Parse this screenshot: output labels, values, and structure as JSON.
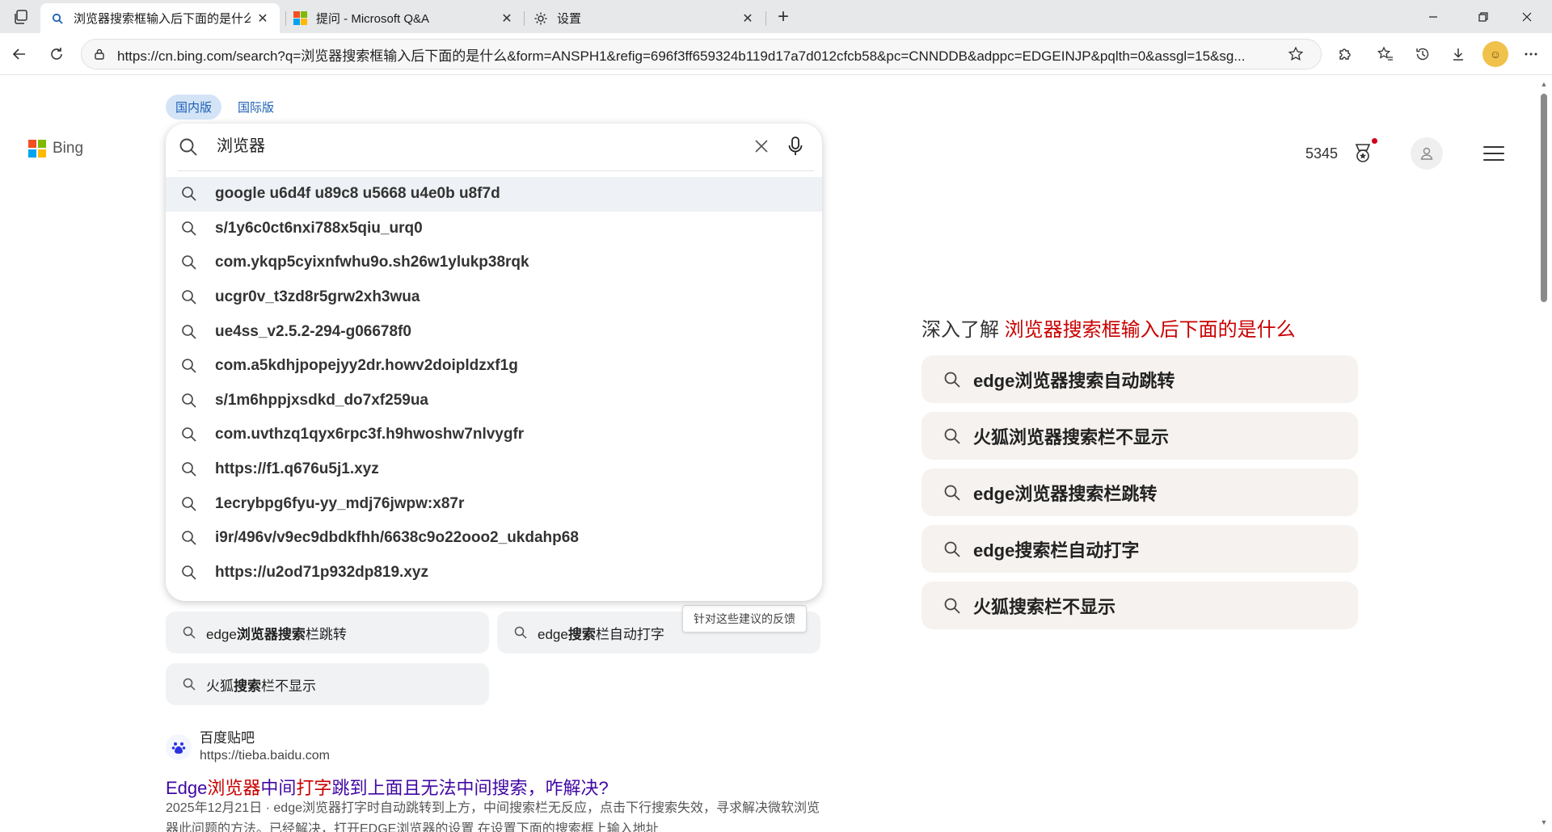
{
  "tabs": [
    {
      "title": "浏览器搜索框输入后下面的是什么",
      "active": true
    },
    {
      "title": "提问 - Microsoft Q&A",
      "active": false
    },
    {
      "title": "设置",
      "active": false
    }
  ],
  "address_bar": {
    "url": "https://cn.bing.com/search?q=浏览器搜索框输入后下面的是什么&form=ANSPH1&refig=696f3ff659324b119d17a7d012cfcb58&pc=CNNDDB&adppc=EDGEINJP&pqlth=0&assgl=15&sg..."
  },
  "bing": {
    "logo_text": "Bing",
    "market_tabs": [
      "国内版",
      "国际版"
    ],
    "points": "5345"
  },
  "search": {
    "query": "浏览器",
    "suggestions": [
      "google u6d4f u89c8 u5668 u4e0b u8f7d",
      "s/1y6c0ct6nxi788x5qiu_urq0",
      "com.ykqp5cyixnfwhu9o.sh26w1ylukp38rqk",
      "ucgr0v_t3zd8r5grw2xh3wua",
      "ue4ss_v2.5.2-294-g06678f0",
      "com.a5kdhjpopejyy2dr.howv2doipldzxf1g",
      "s/1m6hppjxsdkd_do7xf259ua",
      "com.uvthzq1qyx6rpc3f.h9hwoshw7nlvygfr",
      "https://f1.q676u5j1.xyz",
      "1ecrybpg6fyu-yy_mdj76jwpw:x87r",
      "i9r/496v/v9ec9dbdkfhh/6638c9o22ooo2_ukdahp68",
      "https://u2od71p932dp819.xyz"
    ]
  },
  "related_pills": [
    {
      "pre": "edge",
      "bold": "浏览器搜索",
      "post": "栏跳转"
    },
    {
      "pre": "edge",
      "bold": "搜索",
      "post": "栏自动打字"
    },
    {
      "pre": "火狐",
      "bold": "搜索",
      "post": "栏不显示"
    }
  ],
  "feedback_tip": "针对这些建议的反馈",
  "result": {
    "source_name": "百度贴吧",
    "source_url": "https://tieba.baidu.com",
    "title_parts": [
      {
        "text": "Edge",
        "em": false
      },
      {
        "text": "浏览器",
        "em": true
      },
      {
        "text": "中间",
        "em": false
      },
      {
        "text": "打字",
        "em": true
      },
      {
        "text": "跳到上面且无法中间搜索，咋解决?",
        "em": false
      }
    ],
    "snippet": "2025年12月21日 · edge浏览器打字时自动跳转到上方，中间搜索栏无反应，点击下行搜索失效，寻求解决微软浏览器此问题的方法。已经解决，打开EDGE浏览器的设置 在设置下面的搜索框上输入地址"
  },
  "deep_dive": {
    "prefix": "深入了解",
    "query": "浏览器搜索框输入后下面的是什么",
    "items": [
      "edge浏览器搜索自动跳转",
      "火狐浏览器搜索栏不显示",
      "edge浏览器搜索栏跳转",
      "edge搜索栏自动打字",
      "火狐搜索栏不显示"
    ]
  },
  "colors": {
    "accent_blue": "#1b5fb3",
    "result_title": "#4007a2",
    "highlight_red": "#c80000",
    "ms_logo": [
      "#f25022",
      "#7fba00",
      "#00a4ef",
      "#ffb900"
    ]
  }
}
